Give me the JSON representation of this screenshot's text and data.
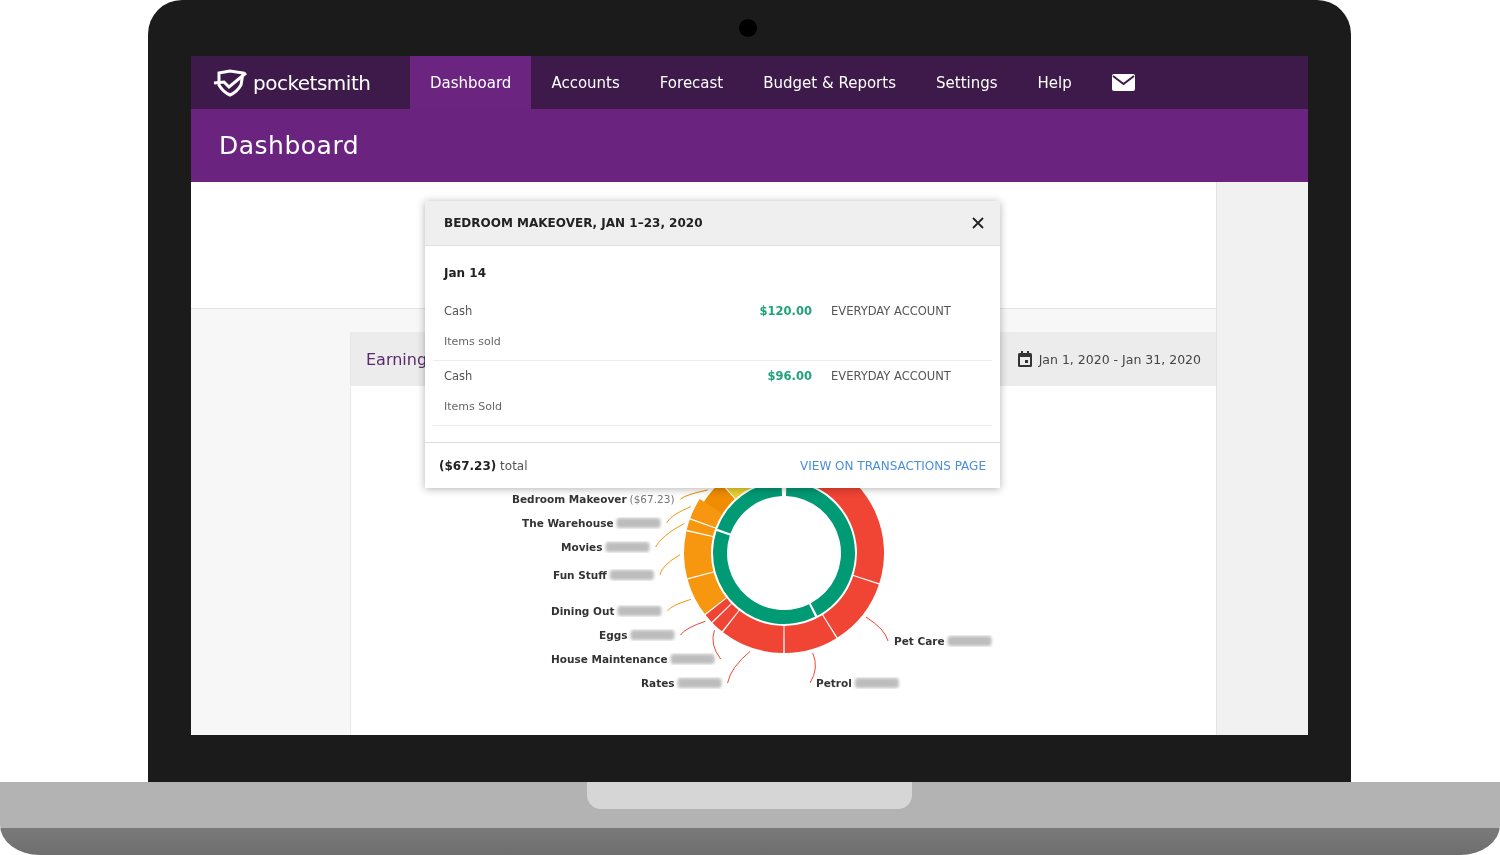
{
  "nav": {
    "logo": "pocketsmith",
    "tabs": [
      {
        "label": "Dashboard",
        "selected": true
      },
      {
        "label": "Accounts",
        "selected": false
      },
      {
        "label": "Forecast",
        "selected": false
      },
      {
        "label": "Budget & Reports",
        "selected": false
      },
      {
        "label": "Settings",
        "selected": false
      },
      {
        "label": "Help",
        "selected": false
      }
    ]
  },
  "page_title": "Dashboard",
  "panel": {
    "title": "Earning",
    "date_range": "Jan 1, 2020 - Jan 31, 2020",
    "slices": [
      {
        "label": "Bedroom Makeover",
        "amount": "($67.23)",
        "color": "#f08c00"
      },
      {
        "label": "The Warehouse",
        "color": "#f7960f"
      },
      {
        "label": "Movies",
        "color": "#f7960f"
      },
      {
        "label": "Fun Stuff",
        "color": "#f7960f"
      },
      {
        "label": "Dining Out",
        "color": "#f7960f"
      },
      {
        "label": "Eggs",
        "color": "#f04434"
      },
      {
        "label": "House Maintenance",
        "color": "#f04434"
      },
      {
        "label": "Rates",
        "color": "#f04434"
      },
      {
        "label": "Pet Care",
        "color": "#f04434"
      },
      {
        "label": "Petrol",
        "color": "#f04434"
      },
      {
        "color": "#f04434"
      },
      {
        "color": "#e8d230"
      }
    ]
  },
  "popup": {
    "title": "BEDROOM MAKEOVER, JAN 1–23, 2020",
    "date": "Jan 14",
    "rows": [
      {
        "payee": "Cash",
        "amount": "$120.00",
        "income": true,
        "account": "EVERYDAY ACCOUNT",
        "note": "Items sold"
      },
      {
        "payee": "Cash",
        "amount": "$96.00",
        "income": true,
        "account": "EVERYDAY ACCOUNT",
        "note": "Items Sold"
      }
    ],
    "total": "**($67.23)** total",
    "link": "VIEW ON TRANSACTIONS PAGE"
  }
}
